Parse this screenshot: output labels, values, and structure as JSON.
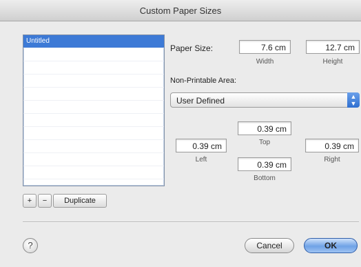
{
  "window": {
    "title": "Custom Paper Sizes"
  },
  "sizes_list": {
    "items": [
      "Untitled",
      "",
      "",
      "",
      "",
      "",
      "",
      "",
      "",
      "",
      "",
      ""
    ]
  },
  "list_buttons": {
    "add": "+",
    "remove": "−",
    "duplicate": "Duplicate"
  },
  "paper_size": {
    "label": "Paper Size:",
    "width": {
      "value": "7.6 cm",
      "caption": "Width"
    },
    "height": {
      "value": "12.7 cm",
      "caption": "Height"
    }
  },
  "non_printable": {
    "label": "Non-Printable Area:",
    "selected": "User Defined",
    "top": {
      "value": "0.39 cm",
      "caption": "Top"
    },
    "left": {
      "value": "0.39 cm",
      "caption": "Left"
    },
    "right": {
      "value": "0.39 cm",
      "caption": "Right"
    },
    "bottom": {
      "value": "0.39 cm",
      "caption": "Bottom"
    }
  },
  "footer": {
    "help": "?",
    "cancel": "Cancel",
    "ok": "OK"
  },
  "colors": {
    "selection": "#3d7ad6",
    "default_button": "#6fa2e6"
  }
}
